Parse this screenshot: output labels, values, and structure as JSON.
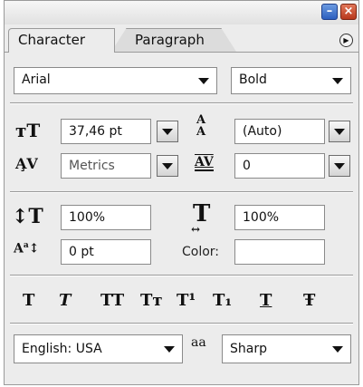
{
  "panel": {
    "tabs": [
      {
        "label": "Character"
      },
      {
        "label": "Paragraph"
      }
    ]
  },
  "font": {
    "family": "Arial",
    "style": "Bold"
  },
  "size": {
    "font_size": "37,46 pt",
    "leading": "(Auto)"
  },
  "spacing": {
    "kerning": "Metrics",
    "tracking": "0"
  },
  "scale": {
    "vertical": "100%",
    "horizontal": "100%"
  },
  "baseline": {
    "shift": "0 pt",
    "color_label": "Color:"
  },
  "style_buttons": [
    {
      "name": "faux-bold",
      "glyph": "T"
    },
    {
      "name": "faux-italic",
      "glyph": "T"
    },
    {
      "name": "all-caps",
      "glyph": "TT"
    },
    {
      "name": "small-caps",
      "glyph": "Tт"
    },
    {
      "name": "superscript",
      "glyph": "T¹"
    },
    {
      "name": "subscript",
      "glyph": "T₁"
    },
    {
      "name": "underline",
      "glyph": "T"
    },
    {
      "name": "strikethrough",
      "glyph": "Ŧ"
    }
  ],
  "language": {
    "value": "English: USA",
    "antialias_icon_text": "aa",
    "antialias": "Sharp"
  },
  "colors": {
    "panel_bg": "#ececec",
    "close_button": "#b8381c",
    "minimize_button": "#2c5fbf"
  }
}
